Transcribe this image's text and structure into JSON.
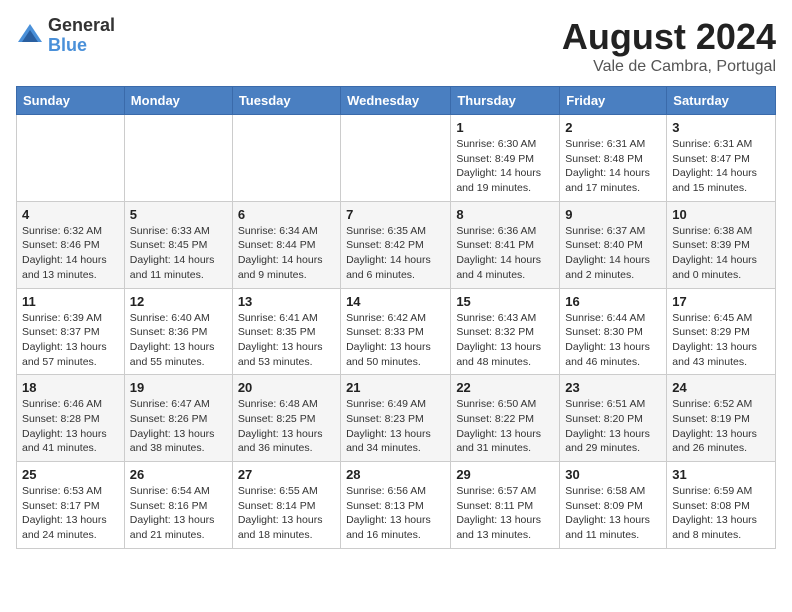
{
  "logo": {
    "general": "General",
    "blue": "Blue"
  },
  "title": "August 2024",
  "subtitle": "Vale de Cambra, Portugal",
  "weekdays": [
    "Sunday",
    "Monday",
    "Tuesday",
    "Wednesday",
    "Thursday",
    "Friday",
    "Saturday"
  ],
  "weeks": [
    [
      {
        "day": "",
        "info": ""
      },
      {
        "day": "",
        "info": ""
      },
      {
        "day": "",
        "info": ""
      },
      {
        "day": "",
        "info": ""
      },
      {
        "day": "1",
        "info": "Sunrise: 6:30 AM\nSunset: 8:49 PM\nDaylight: 14 hours and 19 minutes."
      },
      {
        "day": "2",
        "info": "Sunrise: 6:31 AM\nSunset: 8:48 PM\nDaylight: 14 hours and 17 minutes."
      },
      {
        "day": "3",
        "info": "Sunrise: 6:31 AM\nSunset: 8:47 PM\nDaylight: 14 hours and 15 minutes."
      }
    ],
    [
      {
        "day": "4",
        "info": "Sunrise: 6:32 AM\nSunset: 8:46 PM\nDaylight: 14 hours and 13 minutes."
      },
      {
        "day": "5",
        "info": "Sunrise: 6:33 AM\nSunset: 8:45 PM\nDaylight: 14 hours and 11 minutes."
      },
      {
        "day": "6",
        "info": "Sunrise: 6:34 AM\nSunset: 8:44 PM\nDaylight: 14 hours and 9 minutes."
      },
      {
        "day": "7",
        "info": "Sunrise: 6:35 AM\nSunset: 8:42 PM\nDaylight: 14 hours and 6 minutes."
      },
      {
        "day": "8",
        "info": "Sunrise: 6:36 AM\nSunset: 8:41 PM\nDaylight: 14 hours and 4 minutes."
      },
      {
        "day": "9",
        "info": "Sunrise: 6:37 AM\nSunset: 8:40 PM\nDaylight: 14 hours and 2 minutes."
      },
      {
        "day": "10",
        "info": "Sunrise: 6:38 AM\nSunset: 8:39 PM\nDaylight: 14 hours and 0 minutes."
      }
    ],
    [
      {
        "day": "11",
        "info": "Sunrise: 6:39 AM\nSunset: 8:37 PM\nDaylight: 13 hours and 57 minutes."
      },
      {
        "day": "12",
        "info": "Sunrise: 6:40 AM\nSunset: 8:36 PM\nDaylight: 13 hours and 55 minutes."
      },
      {
        "day": "13",
        "info": "Sunrise: 6:41 AM\nSunset: 8:35 PM\nDaylight: 13 hours and 53 minutes."
      },
      {
        "day": "14",
        "info": "Sunrise: 6:42 AM\nSunset: 8:33 PM\nDaylight: 13 hours and 50 minutes."
      },
      {
        "day": "15",
        "info": "Sunrise: 6:43 AM\nSunset: 8:32 PM\nDaylight: 13 hours and 48 minutes."
      },
      {
        "day": "16",
        "info": "Sunrise: 6:44 AM\nSunset: 8:30 PM\nDaylight: 13 hours and 46 minutes."
      },
      {
        "day": "17",
        "info": "Sunrise: 6:45 AM\nSunset: 8:29 PM\nDaylight: 13 hours and 43 minutes."
      }
    ],
    [
      {
        "day": "18",
        "info": "Sunrise: 6:46 AM\nSunset: 8:28 PM\nDaylight: 13 hours and 41 minutes."
      },
      {
        "day": "19",
        "info": "Sunrise: 6:47 AM\nSunset: 8:26 PM\nDaylight: 13 hours and 38 minutes."
      },
      {
        "day": "20",
        "info": "Sunrise: 6:48 AM\nSunset: 8:25 PM\nDaylight: 13 hours and 36 minutes."
      },
      {
        "day": "21",
        "info": "Sunrise: 6:49 AM\nSunset: 8:23 PM\nDaylight: 13 hours and 34 minutes."
      },
      {
        "day": "22",
        "info": "Sunrise: 6:50 AM\nSunset: 8:22 PM\nDaylight: 13 hours and 31 minutes."
      },
      {
        "day": "23",
        "info": "Sunrise: 6:51 AM\nSunset: 8:20 PM\nDaylight: 13 hours and 29 minutes."
      },
      {
        "day": "24",
        "info": "Sunrise: 6:52 AM\nSunset: 8:19 PM\nDaylight: 13 hours and 26 minutes."
      }
    ],
    [
      {
        "day": "25",
        "info": "Sunrise: 6:53 AM\nSunset: 8:17 PM\nDaylight: 13 hours and 24 minutes."
      },
      {
        "day": "26",
        "info": "Sunrise: 6:54 AM\nSunset: 8:16 PM\nDaylight: 13 hours and 21 minutes."
      },
      {
        "day": "27",
        "info": "Sunrise: 6:55 AM\nSunset: 8:14 PM\nDaylight: 13 hours and 18 minutes."
      },
      {
        "day": "28",
        "info": "Sunrise: 6:56 AM\nSunset: 8:13 PM\nDaylight: 13 hours and 16 minutes."
      },
      {
        "day": "29",
        "info": "Sunrise: 6:57 AM\nSunset: 8:11 PM\nDaylight: 13 hours and 13 minutes."
      },
      {
        "day": "30",
        "info": "Sunrise: 6:58 AM\nSunset: 8:09 PM\nDaylight: 13 hours and 11 minutes."
      },
      {
        "day": "31",
        "info": "Sunrise: 6:59 AM\nSunset: 8:08 PM\nDaylight: 13 hours and 8 minutes."
      }
    ]
  ]
}
